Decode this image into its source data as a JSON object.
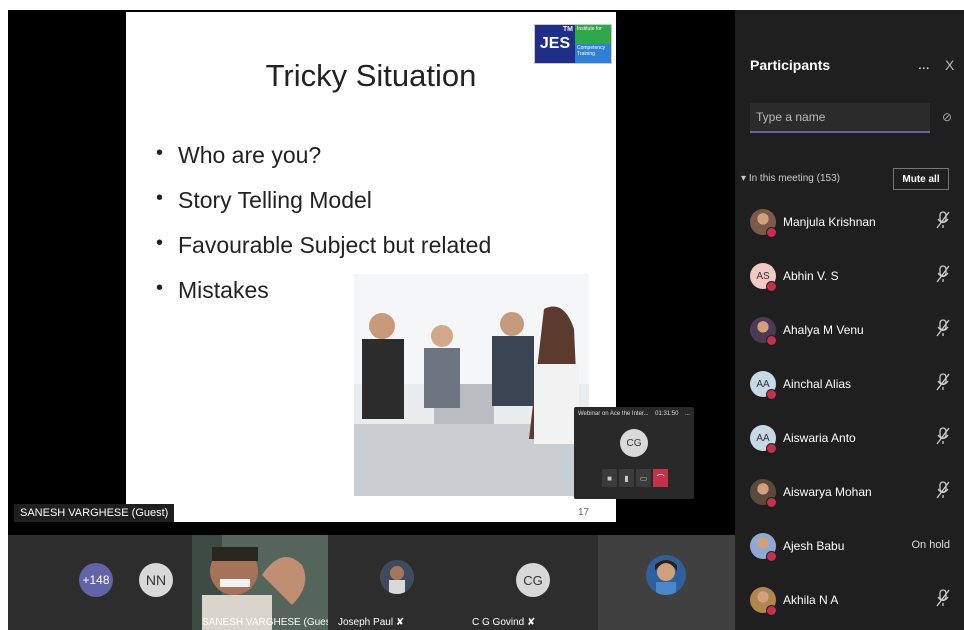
{
  "slide": {
    "logo_text": "JES",
    "logo_tm": "TM",
    "logo_line1": "Institute for",
    "logo_line2": "Competency Training",
    "title": "Tricky Situation",
    "bullets": [
      "Who are you?",
      "Story Telling Model",
      "Favourable Subject but related",
      "Mistakes"
    ],
    "page_number": "17"
  },
  "presenter_caption": "SANESH VARGHESE (Guest)",
  "mini_window": {
    "title": "Webinar on Ace the Inter...",
    "time": "01:31:50",
    "more": "...",
    "avatar_initials": "CG"
  },
  "strip": {
    "overflow_count": "+148",
    "nn_initials": "NN",
    "tiles": [
      {
        "name": "SANESH VARGHESE (Guest)"
      },
      {
        "name": "Joseph Paul"
      },
      {
        "name": "C G Govind",
        "initials": "CG"
      }
    ]
  },
  "panel": {
    "title": "Participants",
    "more": "...",
    "close": "X",
    "search_placeholder": "Type a name",
    "section_label": "In this meeting (153)",
    "mute_all": "Mute all",
    "participants": [
      {
        "name": "Manjula Krishnan",
        "avatar": "photo",
        "status": "muted"
      },
      {
        "name": "Abhin V. S",
        "initials": "AS",
        "status": "muted"
      },
      {
        "name": "Ahalya M Venu",
        "avatar": "photo",
        "status": "muted"
      },
      {
        "name": "Ainchal Alias",
        "initials": "AA",
        "status": "muted"
      },
      {
        "name": "Aiswaria Anto",
        "initials": "AA",
        "status": "muted"
      },
      {
        "name": "Aiswarya Mohan",
        "avatar": "photo",
        "status": "muted"
      },
      {
        "name": "Ajesh Babu",
        "avatar": "photo",
        "status_text": "On hold"
      },
      {
        "name": "Akhila N A",
        "avatar": "photo",
        "status": "muted"
      }
    ]
  }
}
